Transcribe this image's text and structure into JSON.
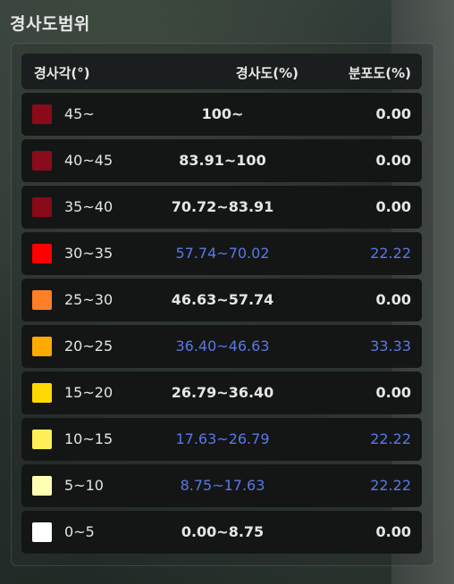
{
  "panel": {
    "title": "경사도범위"
  },
  "table": {
    "headers": {
      "angle": "경사각(°)",
      "slope": "경사도(%)",
      "distribution": "분포도(%)"
    },
    "highlight_color": "#5a77e6",
    "rows": [
      {
        "angle": "45~",
        "slope": "100~",
        "distribution": "0.00",
        "color": "#8b0a1a",
        "highlighted": false
      },
      {
        "angle": "40~45",
        "slope": "83.91~100",
        "distribution": "0.00",
        "color": "#8a0b1c",
        "highlighted": false
      },
      {
        "angle": "35~40",
        "slope": "70.72~83.91",
        "distribution": "0.00",
        "color": "#870a1b",
        "highlighted": false
      },
      {
        "angle": "30~35",
        "slope": "57.74~70.02",
        "distribution": "22.22",
        "color": "#ff0000",
        "highlighted": true
      },
      {
        "angle": "25~30",
        "slope": "46.63~57.74",
        "distribution": "0.00",
        "color": "#ff7f27",
        "highlighted": false
      },
      {
        "angle": "20~25",
        "slope": "36.40~46.63",
        "distribution": "33.33",
        "color": "#ffaa00",
        "highlighted": true
      },
      {
        "angle": "15~20",
        "slope": "26.79~36.40",
        "distribution": "0.00",
        "color": "#ffd800",
        "highlighted": false
      },
      {
        "angle": "10~15",
        "slope": "17.63~26.79",
        "distribution": "22.22",
        "color": "#ffee55",
        "highlighted": true
      },
      {
        "angle": "5~10",
        "slope": "8.75~17.63",
        "distribution": "22.22",
        "color": "#ffffb4",
        "highlighted": true
      },
      {
        "angle": "0~5",
        "slope": "0.00~8.75",
        "distribution": "0.00",
        "color": "#ffffff",
        "highlighted": false
      }
    ]
  }
}
